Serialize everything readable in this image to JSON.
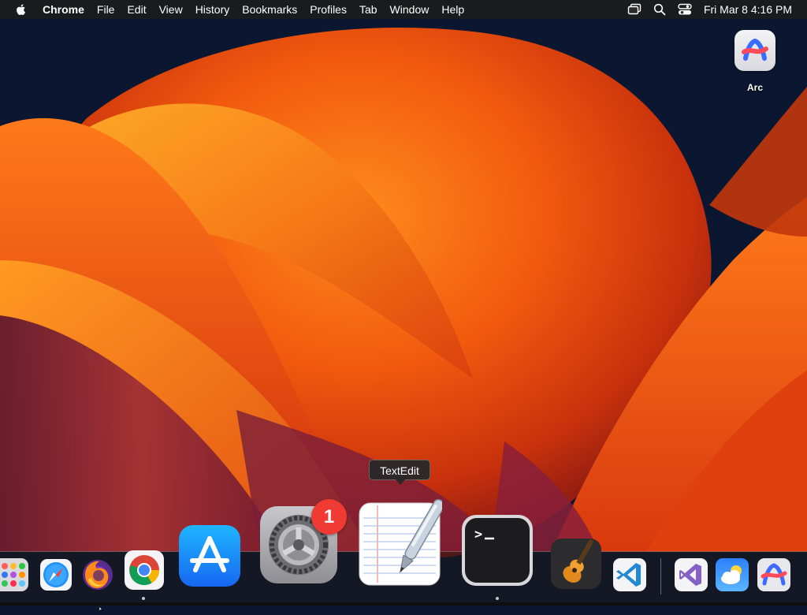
{
  "menubar": {
    "app_name": "Chrome",
    "menus": [
      "File",
      "Edit",
      "View",
      "History",
      "Bookmarks",
      "Profiles",
      "Tab",
      "Window",
      "Help"
    ],
    "clock": "Fri Mar 8  4:16 PM",
    "icons": [
      "apple-logo-icon",
      "screen-mirroring-icon",
      "spotlight-search-icon",
      "control-center-icon"
    ]
  },
  "desktop": {
    "icons": [
      {
        "label": "Arc",
        "icon": "arc-icon"
      }
    ]
  },
  "tooltip": {
    "text": "TextEdit"
  },
  "dock": {
    "items": [
      {
        "name": "Launchpad",
        "icon": "launchpad-icon"
      },
      {
        "name": "Safari",
        "icon": "safari-icon"
      },
      {
        "name": "Firefox",
        "icon": "firefox-icon"
      },
      {
        "name": "Google Chrome",
        "icon": "chrome-icon",
        "running": true
      },
      {
        "name": "App Store",
        "icon": "app-store-icon"
      },
      {
        "name": "System Settings",
        "icon": "system-settings-icon",
        "badge": "1"
      },
      {
        "name": "TextEdit",
        "icon": "textedit-icon",
        "hovered": true
      },
      {
        "name": "Terminal",
        "icon": "terminal-icon",
        "running": true
      },
      {
        "name": "GarageBand",
        "icon": "garageband-icon"
      },
      {
        "name": "Visual Studio Code",
        "icon": "vscode-icon"
      },
      {
        "name": "Visual Studio",
        "icon": "visual-studio-icon"
      },
      {
        "name": "Weather",
        "icon": "weather-icon"
      },
      {
        "name": "Arc",
        "icon": "arc-icon"
      }
    ],
    "system_settings_badge": "1"
  },
  "colors": {
    "menubar_bg": "#1c1c1e",
    "badge_red": "#ef3b33",
    "wallpaper_dark": "#0b1730",
    "wallpaper_orange": "#f5660f"
  }
}
